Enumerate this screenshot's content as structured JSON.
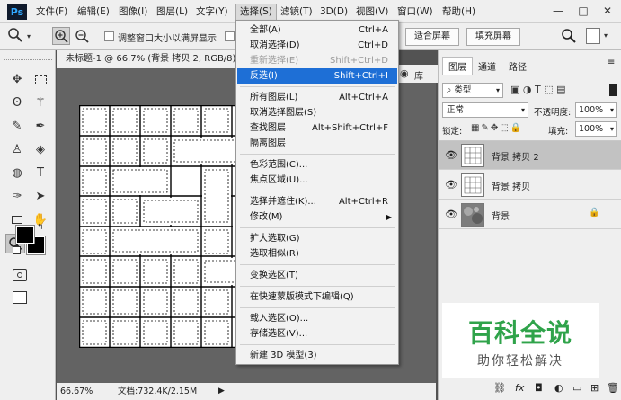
{
  "app": {
    "logo": "Ps"
  },
  "menubar": {
    "items": [
      "文件(F)",
      "编辑(E)",
      "图像(I)",
      "图层(L)",
      "文字(Y)",
      "选择(S)",
      "滤镜(T)",
      "3D(D)",
      "视图(V)",
      "窗口(W)",
      "帮助(H)"
    ],
    "active_index": 5,
    "window_controls": [
      "—",
      "□",
      "✕"
    ]
  },
  "options_bar": {
    "checkbox_label": "调整窗口大小以满屏显示",
    "fit_screen_label": "适合屏幕",
    "fill_screen_label": "填充屏幕"
  },
  "document": {
    "tab_title": "未标题-1 @ 66.7% (背景 拷贝 2, RGB/8) *",
    "zoom": "66.67%",
    "doc_info": "文档:732.4K/2.15M"
  },
  "select_menu": {
    "items": [
      {
        "label": "全部(A)",
        "shortcut": "Ctrl+A",
        "state": "normal"
      },
      {
        "label": "取消选择(D)",
        "shortcut": "Ctrl+D",
        "state": "normal"
      },
      {
        "label": "重新选择(E)",
        "shortcut": "Shift+Ctrl+D",
        "state": "disabled"
      },
      {
        "label": "反选(I)",
        "shortcut": "Shift+Ctrl+I",
        "state": "highlighted"
      },
      {
        "label": "所有图层(L)",
        "shortcut": "Alt+Ctrl+A",
        "state": "normal"
      },
      {
        "label": "取消选择图层(S)",
        "shortcut": "",
        "state": "normal"
      },
      {
        "label": "查找图层",
        "shortcut": "Alt+Shift+Ctrl+F",
        "state": "normal"
      },
      {
        "label": "隔离图层",
        "shortcut": "",
        "state": "normal"
      },
      {
        "label": "色彩范围(C)...",
        "shortcut": "",
        "state": "normal"
      },
      {
        "label": "焦点区域(U)...",
        "shortcut": "",
        "state": "normal"
      },
      {
        "label": "选择并遮住(K)...",
        "shortcut": "Alt+Ctrl+R",
        "state": "normal"
      },
      {
        "label": "修改(M)",
        "shortcut": "",
        "state": "submenu"
      },
      {
        "label": "扩大选取(G)",
        "shortcut": "",
        "state": "normal"
      },
      {
        "label": "选取相似(R)",
        "shortcut": "",
        "state": "normal"
      },
      {
        "label": "变换选区(T)",
        "shortcut": "",
        "state": "normal"
      },
      {
        "label": "在快速蒙版模式下编辑(Q)",
        "shortcut": "",
        "state": "normal"
      },
      {
        "label": "载入选区(O)...",
        "shortcut": "",
        "state": "normal"
      },
      {
        "label": "存储选区(V)...",
        "shortcut": "",
        "state": "normal"
      },
      {
        "label": "新建 3D 模型(3)",
        "shortcut": "",
        "state": "normal"
      }
    ],
    "submenu_arrow": "▶"
  },
  "panel_strip": {
    "label": "库"
  },
  "layers_panel": {
    "tabs": [
      "图层",
      "通道",
      "路径"
    ],
    "filter_kind": "类型",
    "blend_mode": "正常",
    "opacity_label": "不透明度:",
    "opacity_value": "100%",
    "lock_label": "锁定:",
    "fill_label": "填充:",
    "fill_value": "100%",
    "layers": [
      {
        "name": "背景 拷贝 2",
        "selected": true,
        "locked": false
      },
      {
        "name": "背景 拷贝",
        "selected": false,
        "locked": false
      },
      {
        "name": "背景",
        "selected": false,
        "locked": true
      }
    ],
    "footer_icons": [
      "link-icon",
      "fx-icon",
      "mask-icon",
      "adjustment-icon",
      "group-icon",
      "new-layer-icon",
      "trash-icon"
    ],
    "fx_label": "fx"
  },
  "watermark": {
    "title": "百科全说",
    "subtitle": "助你轻松解决"
  },
  "colors": {
    "accent": "#1e6fd6",
    "ui_bg": "#efefef",
    "workspace": "#636363",
    "watermark_green": "#2fa34a"
  }
}
